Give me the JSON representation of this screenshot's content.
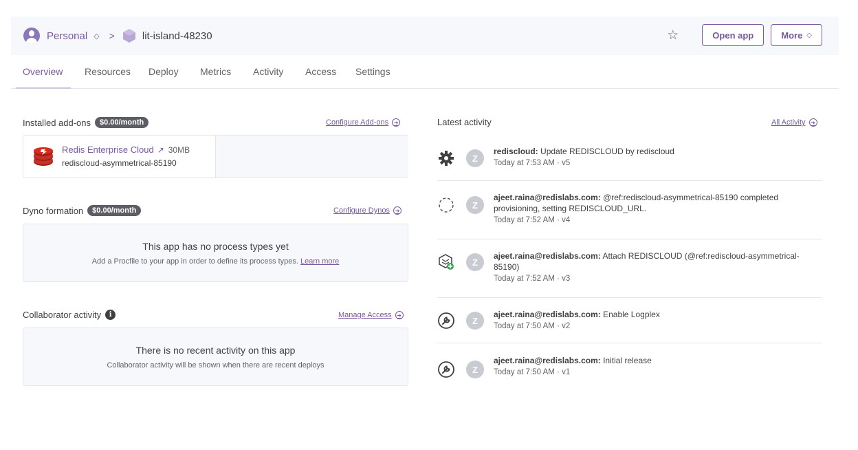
{
  "header": {
    "account": "Personal",
    "app_name": "lit-island-48230",
    "open_app_label": "Open app",
    "more_label": "More",
    "star_icon": "star-icon",
    "updown_glyph": "◇",
    "chevron_glyph": ">"
  },
  "tabs": [
    {
      "label": "Overview",
      "active": true
    },
    {
      "label": "Resources"
    },
    {
      "label": "Deploy"
    },
    {
      "label": "Metrics"
    },
    {
      "label": "Activity"
    },
    {
      "label": "Access"
    },
    {
      "label": "Settings"
    }
  ],
  "addons": {
    "title": "Installed add-ons",
    "price": "$0.00/month",
    "configure_label": "Configure Add-ons",
    "item": {
      "name": "Redis Enterprise Cloud",
      "size": "30MB",
      "sub": "rediscloud-asymmetrical-85190"
    }
  },
  "dynos": {
    "title": "Dyno formation",
    "price": "$0.00/month",
    "configure_label": "Configure Dynos",
    "empty_title": "This app has no process types yet",
    "empty_sub": "Add a Procfile to your app in order to define its process types.",
    "learn_more": "Learn more"
  },
  "collab": {
    "title": "Collaborator activity",
    "manage_label": "Manage Access",
    "empty_title": "There is no recent activity on this app",
    "empty_sub": "Collaborator activity will be shown when there are recent deploys"
  },
  "activity": {
    "title": "Latest activity",
    "all_label": "All Activity",
    "items": [
      {
        "icon": "gear-icon",
        "user": "rediscloud:",
        "text": " Update REDISCLOUD by rediscloud",
        "time": "Today at 7:53 AM · v5"
      },
      {
        "icon": "dashed-circle-icon",
        "user": "ajeet.raina@redislabs.com:",
        "text": " @ref:rediscloud-asymmetrical-85190 completed provisioning, setting REDISCLOUD_URL.",
        "time": "Today at 7:52 AM · v4"
      },
      {
        "icon": "addon-attach-icon",
        "user": "ajeet.raina@redislabs.com:",
        "text": " Attach REDISCLOUD (@ref:rediscloud-asymmetrical-85190)",
        "time": "Today at 7:52 AM · v3"
      },
      {
        "icon": "wrench-icon",
        "user": "ajeet.raina@redislabs.com:",
        "text": " Enable Logplex",
        "time": "Today at 7:50 AM · v2"
      },
      {
        "icon": "wrench-icon",
        "user": "ajeet.raina@redislabs.com:",
        "text": " Initial release",
        "time": "Today at 7:50 AM · v1"
      }
    ]
  },
  "colors": {
    "accent": "#79589f",
    "header_bg": "#f7f8fb",
    "pill_bg": "#5d5d66",
    "redis_red": "#c6302b"
  }
}
